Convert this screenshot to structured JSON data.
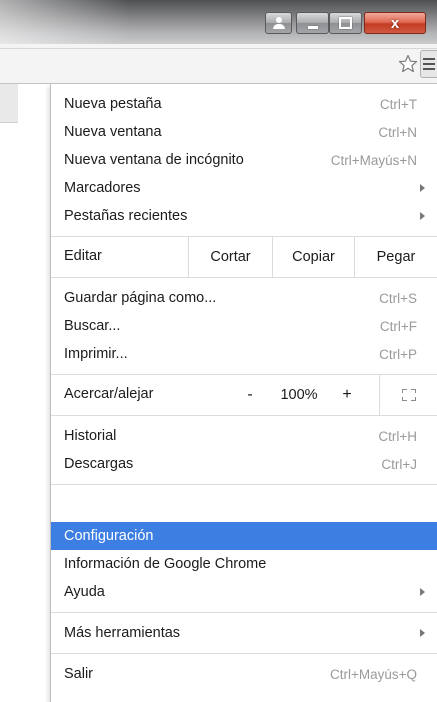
{
  "window": {
    "close_glyph": "x",
    "buttons": [
      "profile-icon",
      "minimize-icon",
      "maximize-icon",
      "close-icon"
    ]
  },
  "toolbar": {
    "star_icon": "star-outline-icon",
    "menu_icon": "hamburger-menu-icon"
  },
  "menu": {
    "group1": [
      {
        "label": "Nueva pestaña",
        "shortcut": "Ctrl+T"
      },
      {
        "label": "Nueva ventana",
        "shortcut": "Ctrl+N"
      },
      {
        "label": "Nueva ventana de incógnito",
        "shortcut": "Ctrl+Mayús+N"
      },
      {
        "label": "Marcadores",
        "submenu": true
      },
      {
        "label": "Pestañas recientes",
        "submenu": true
      }
    ],
    "edit": {
      "label": "Editar",
      "cut": "Cortar",
      "copy": "Copiar",
      "paste": "Pegar"
    },
    "group2": [
      {
        "label": "Guardar página como...",
        "shortcut": "Ctrl+S"
      },
      {
        "label": "Buscar...",
        "shortcut": "Ctrl+F"
      },
      {
        "label": "Imprimir...",
        "shortcut": "Ctrl+P"
      }
    ],
    "zoom": {
      "label": "Acercar/alejar",
      "minus": "-",
      "value": "100%",
      "plus": "+"
    },
    "group3": [
      {
        "label": "Historial",
        "shortcut": "Ctrl+H"
      },
      {
        "label": "Descargas",
        "shortcut": "Ctrl+J"
      }
    ],
    "group4": [
      {
        "label": "Configuración",
        "highlighted": true
      },
      {
        "label": "Información de Google Chrome"
      },
      {
        "label": "Ayuda",
        "submenu": true
      }
    ],
    "group5": [
      {
        "label": "Más herramientas",
        "submenu": true
      }
    ],
    "group6": [
      {
        "label": "Salir",
        "shortcut": "Ctrl+Mayús+Q"
      }
    ],
    "highlight_color": "#3d7ee3"
  }
}
